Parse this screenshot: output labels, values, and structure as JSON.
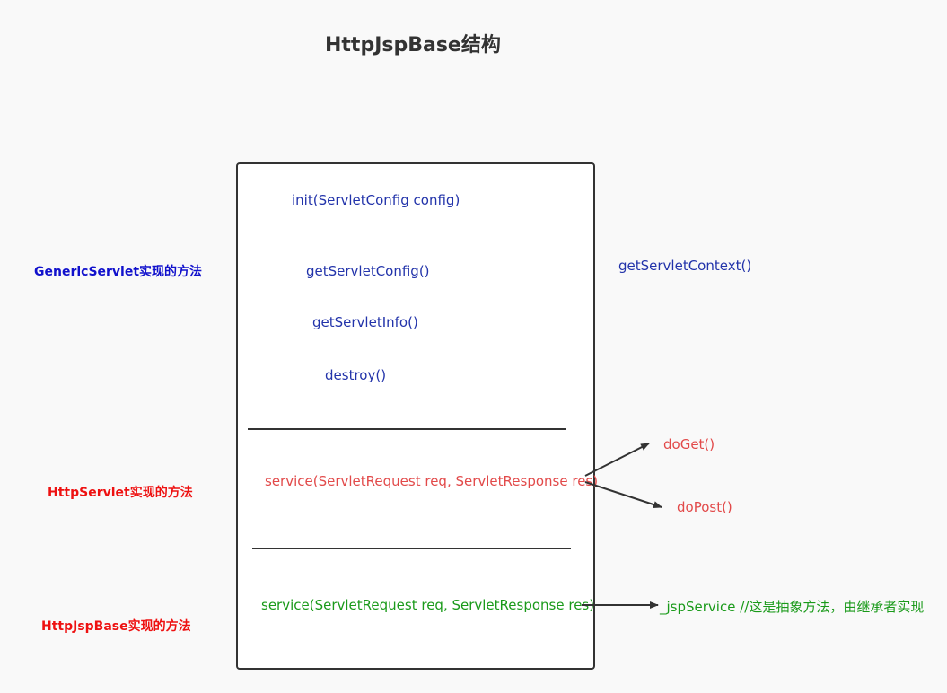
{
  "title": "HttpJspBase结构",
  "box_methods": {
    "init": "init(ServletConfig config)",
    "get_servlet_config": "getServletConfig()",
    "get_servlet_info": "getServletInfo()",
    "destroy": "destroy()",
    "http_service": "service(ServletRequest req, ServletResponse res)",
    "jsp_service": "service(ServletRequest req, ServletResponse res)"
  },
  "outside": {
    "get_servlet_context": "getServletContext()",
    "do_get": "doGet()",
    "do_post": "doPost()",
    "jsp_service_target": "_jspService  //这是抽象方法，由继承者实现"
  },
  "side_labels": {
    "generic": "GenericServlet实现的方法",
    "http": "HttpServlet实现的方法",
    "jsp": "HttpJspBase实现的方法"
  },
  "colors": {
    "generic": "#2233aa",
    "http": "#e24a4a",
    "jsp": "#1a9a1a",
    "label_generic": "#1111cc",
    "label_red": "#ee1111"
  }
}
